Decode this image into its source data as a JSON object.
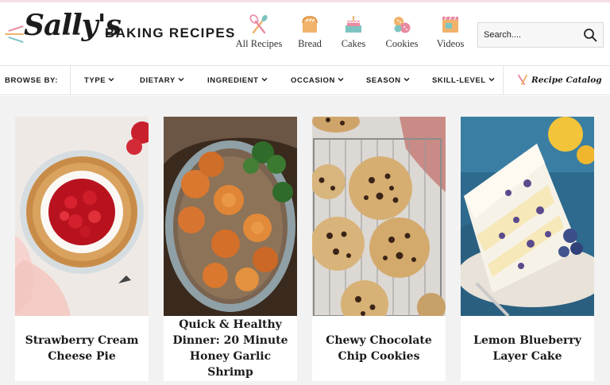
{
  "brand": {
    "script": "Sally's",
    "wordmark": "BAKING RECIPES",
    "dash_colors": [
      "#e88aa0",
      "#f1b36b",
      "#7cc4c2"
    ]
  },
  "nav": {
    "items": [
      {
        "label": "All Recipes",
        "icon": "whisk-spoon-icon"
      },
      {
        "label": "Bread",
        "icon": "bread-loaf-icon"
      },
      {
        "label": "Cakes",
        "icon": "cake-icon"
      },
      {
        "label": "Cookies",
        "icon": "cookies-icon"
      },
      {
        "label": "Videos",
        "icon": "video-camera-icon"
      }
    ]
  },
  "search": {
    "placeholder": "Search....",
    "value": "",
    "icon": "search-icon"
  },
  "browse": {
    "label": "BROWSE BY:",
    "filters": [
      {
        "label": "TYPE"
      },
      {
        "label": "DIETARY"
      },
      {
        "label": "INGREDIENT"
      },
      {
        "label": "OCCASION"
      },
      {
        "label": "SEASON"
      },
      {
        "label": "SKILL-LEVEL"
      }
    ],
    "catalog_label": "Recipe Catalog",
    "catalog_icon": "whisk-icon"
  },
  "cards": [
    {
      "title": "Strawberry Cream Cheese Pie",
      "image": "strawberry-pie-photo"
    },
    {
      "title": "Quick & Healthy Dinner: 20 Minute Honey Garlic Shrimp",
      "image": "honey-garlic-shrimp-photo"
    },
    {
      "title": "Chewy Chocolate Chip Cookies",
      "image": "chocolate-chip-cookies-photo"
    },
    {
      "title": "Lemon Blueberry Layer Cake",
      "image": "lemon-blueberry-cake-photo"
    }
  ],
  "colors": {
    "accent_pink": "#e88aa0",
    "accent_orange": "#f1b36b",
    "accent_teal": "#7cc4c2",
    "background": "#f2f2f2",
    "text": "#1a1a1a"
  }
}
